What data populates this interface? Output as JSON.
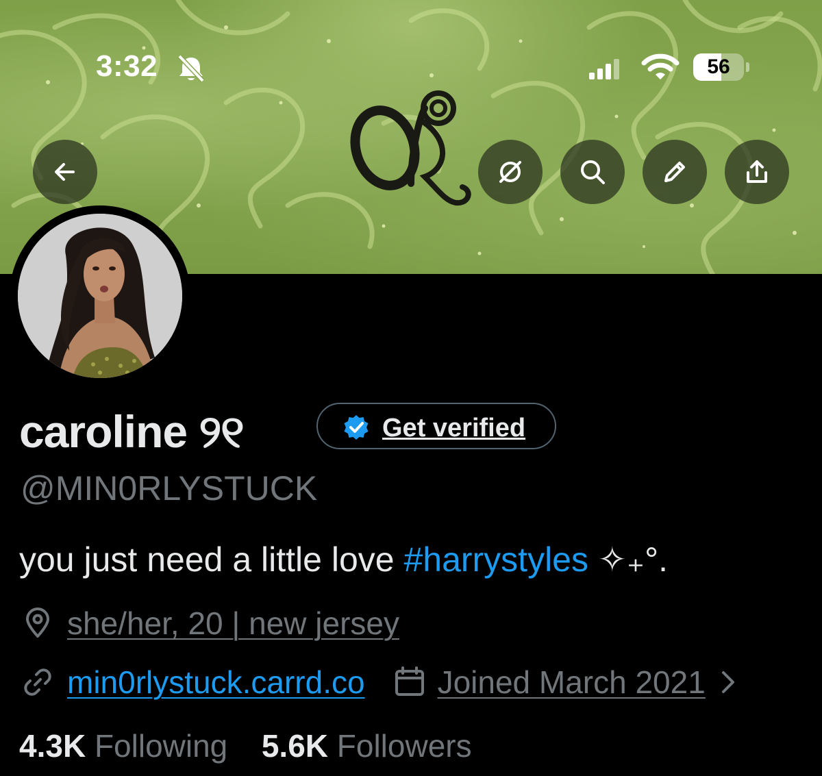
{
  "status_bar": {
    "time": "3:32",
    "battery_level": "56",
    "battery_fraction": 0.56,
    "icons": [
      "bell-slash-icon",
      "cellular-signal-icon",
      "wifi-icon",
      "battery-icon"
    ]
  },
  "banner": {
    "colors": {
      "base": "#86a650",
      "swirl": "#c9dd8f"
    },
    "logo_text": "OR"
  },
  "header": {
    "back_icon": "arrow-left-icon",
    "actions": [
      "grok-icon",
      "search-icon",
      "edit-icon",
      "share-icon"
    ]
  },
  "profile": {
    "display_name": "caroline ୨୧",
    "handle": "@MIN0RLYSTUCK",
    "get_verified_label": "Get verified",
    "bio_text": "you just need a little love ",
    "bio_hashtag": "#harrystyles",
    "bio_suffix": " ✧₊°.",
    "location": "she/her, 20 | new jersey",
    "website": "min0rlystuck.carrd.co",
    "joined": "Joined March 2021",
    "following_count": "4.3K",
    "following_label": "Following",
    "followers_count": "5.6K",
    "followers_label": "Followers"
  },
  "colors": {
    "background": "#000000",
    "text": "#e7e9ea",
    "muted": "#71767b",
    "accent": "#1d9bf0"
  }
}
